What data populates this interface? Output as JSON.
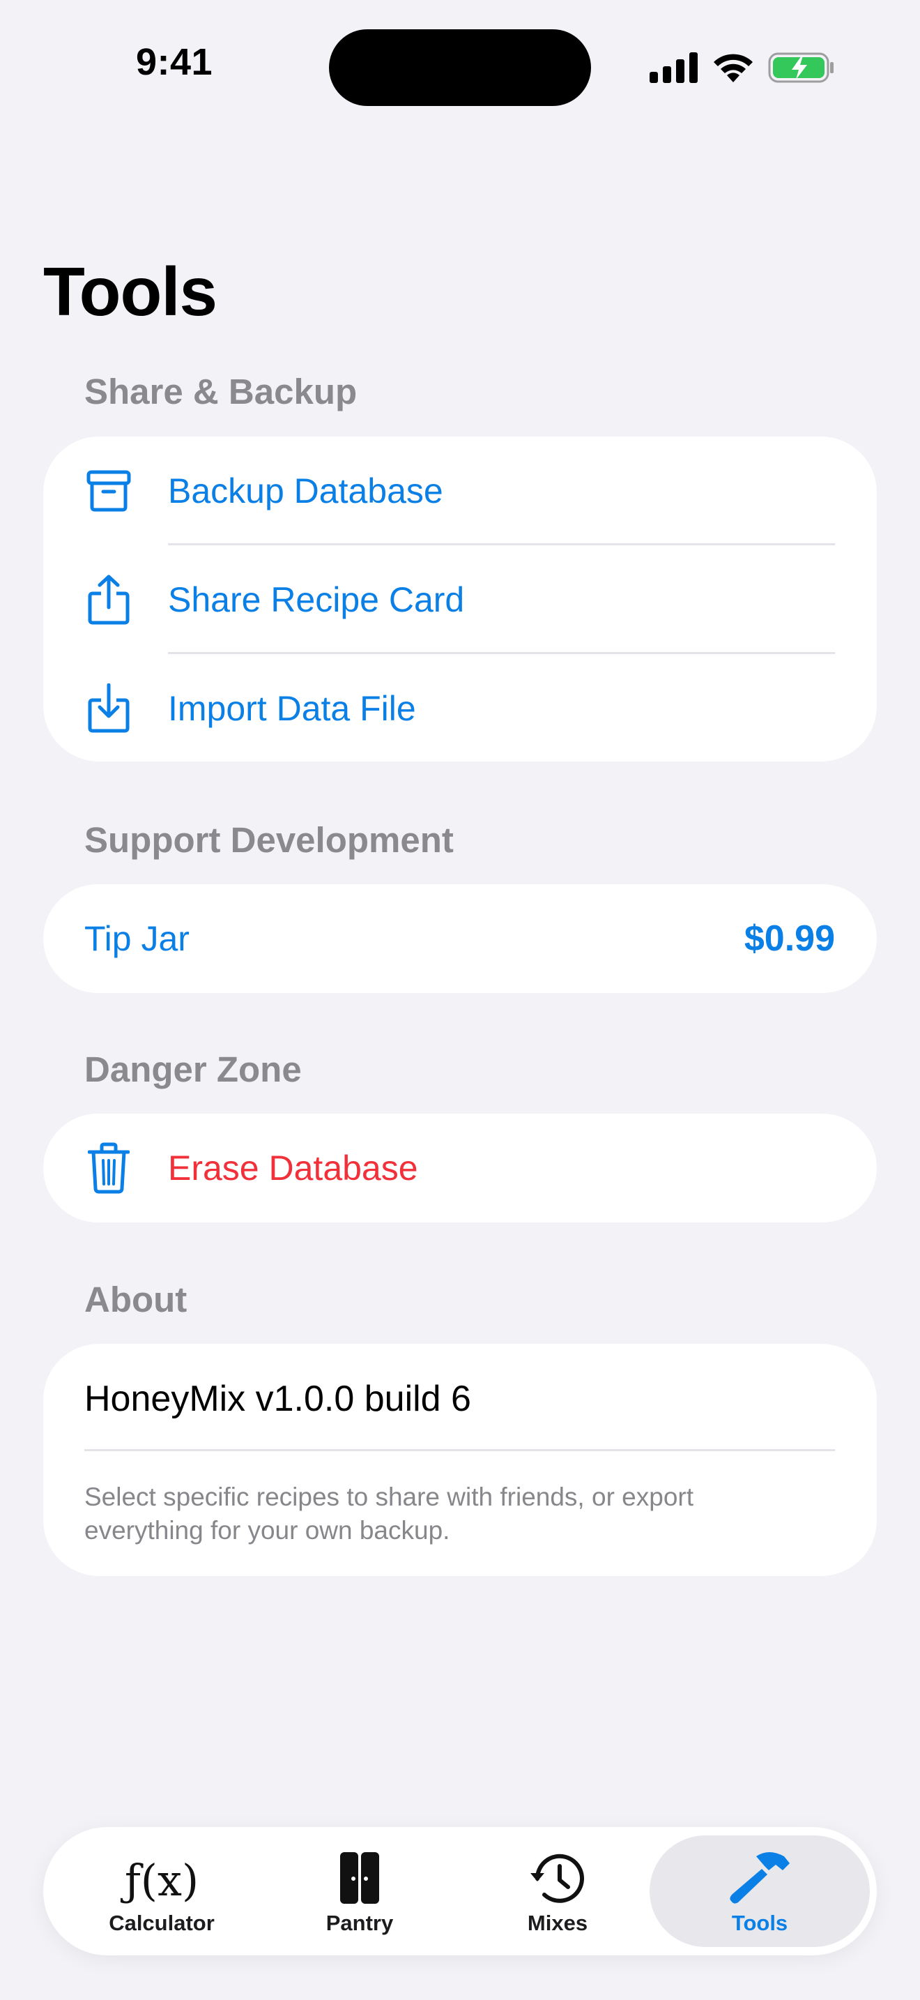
{
  "status_bar": {
    "time": "9:41"
  },
  "page": {
    "title": "Tools"
  },
  "sections": {
    "share_backup": {
      "header": "Share & Backup",
      "items": [
        {
          "label": "Backup Database",
          "icon": "archive-box-icon"
        },
        {
          "label": "Share Recipe Card",
          "icon": "share-icon"
        },
        {
          "label": "Import Data File",
          "icon": "import-icon"
        }
      ]
    },
    "support": {
      "header": "Support Development",
      "tip_label": "Tip Jar",
      "tip_price": "$0.99"
    },
    "danger": {
      "header": "Danger Zone",
      "erase_label": "Erase Database",
      "icon": "trash-icon"
    },
    "about": {
      "header": "About",
      "version": "HoneyMix v1.0.0 build 6",
      "note": "Select specific recipes to share with friends, or export everything for your own backup."
    }
  },
  "tabbar": {
    "tabs": [
      {
        "label": "Calculator",
        "icon": "function-icon"
      },
      {
        "label": "Pantry",
        "icon": "cabinet-icon"
      },
      {
        "label": "Mixes",
        "icon": "history-clock-icon"
      },
      {
        "label": "Tools",
        "icon": "hammer-icon",
        "active": true
      }
    ]
  },
  "colors": {
    "accent": "#0A7FE6",
    "danger": "#F2303A",
    "background": "#F2F2F7",
    "battery": "#34C759"
  }
}
